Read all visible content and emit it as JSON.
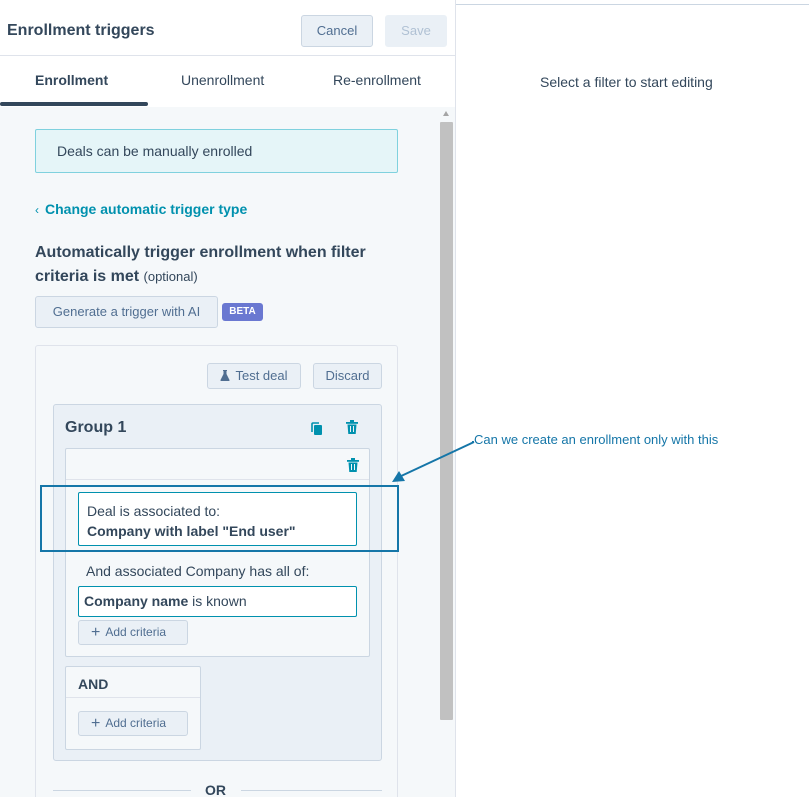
{
  "header": {
    "title": "Enrollment triggers",
    "cancel_label": "Cancel",
    "save_label": "Save"
  },
  "tabs": [
    {
      "label": "Enrollment",
      "active": true
    },
    {
      "label": "Unenrollment",
      "active": false
    },
    {
      "label": "Re-enrollment",
      "active": false
    }
  ],
  "info_banner": "Deals can be manually enrolled",
  "change_trigger_link": "Change automatic trigger type",
  "section": {
    "heading": "Automatically trigger enrollment when filter criteria is met",
    "optional": "(optional)"
  },
  "ai_button": "Generate a trigger with AI",
  "beta_badge": "BETA",
  "filter_card": {
    "test_deal_label": "Test deal",
    "discard_label": "Discard",
    "group_title": "Group 1",
    "association_line1": "Deal is associated to:",
    "association_line2": "Company with label \"End user\"",
    "associated_sub_label": "And associated Company has all of:",
    "company_filter_property": "Company name",
    "company_filter_condition": "is known",
    "add_criteria_label": "Add criteria",
    "and_label": "AND",
    "or_label": "OR"
  },
  "right_panel": {
    "placeholder": "Select a filter to start editing"
  },
  "annotation": {
    "text": "Can we create an enrollment only with this",
    "color": "#1576a8"
  },
  "colors": {
    "link": "#0091ae",
    "beta": "#6a78d1",
    "text": "#33475b"
  },
  "icons": {
    "copy": "copy-icon",
    "trash": "trash-icon",
    "flask": "flask-icon",
    "plus": "plus-icon",
    "chevron": "chevron-left-icon"
  }
}
